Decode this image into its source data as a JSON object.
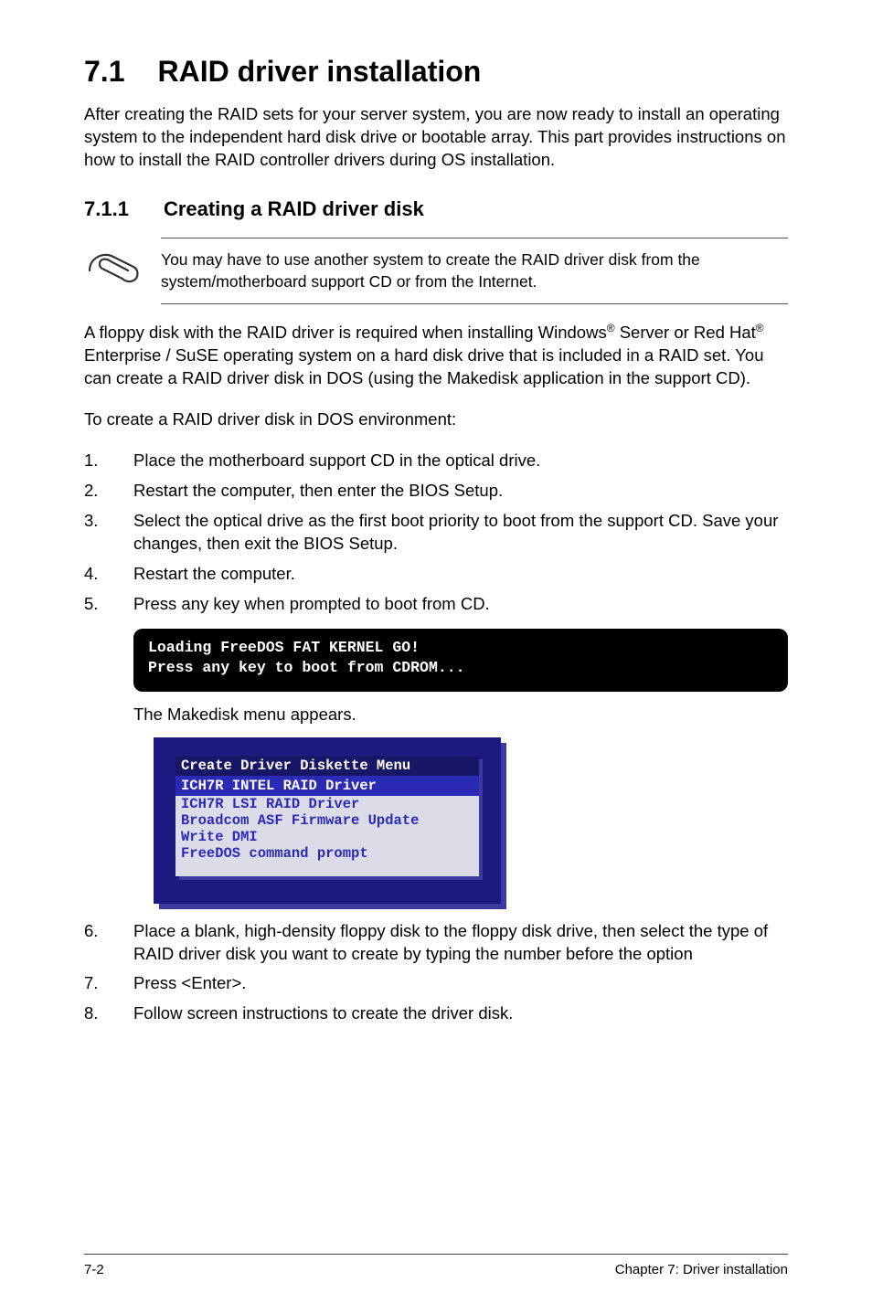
{
  "heading1": {
    "num": "7.1",
    "title": "RAID driver installation"
  },
  "intro": "After creating the RAID sets for your server system, you are now ready to install an operating system to the independent hard disk drive or bootable array. This part provides instructions on how to install the RAID controller drivers during OS installation.",
  "heading2": {
    "num": "7.1.1",
    "title": "Creating a RAID driver disk"
  },
  "note": "You may have to use another system to create the RAID driver disk from the system/motherboard support CD or from the Internet.",
  "para2_a": "A floppy disk with the RAID driver is required when installing Windows",
  "para2_b": " Server or Red Hat",
  "para2_c": " Enterprise / SuSE operating system on a hard disk drive that is included in a RAID set. You can create a RAID driver disk in DOS (using the Makedisk application in the support CD).",
  "para3": "To create a RAID driver disk in DOS environment:",
  "steps_a": [
    "Place the motherboard support CD in the optical drive.",
    "Restart the computer, then enter the BIOS Setup.",
    "Select the optical drive as the first boot priority to boot from the support CD. Save your changes, then exit the BIOS Setup.",
    "Restart the computer.",
    "Press any key when prompted to boot from CD."
  ],
  "terminal": "Loading FreeDOS FAT KERNEL GO!\nPress any key to boot from CDROM...",
  "makedisk_line": "The Makedisk menu appears.",
  "menu": {
    "title": "Create Driver Diskette Menu",
    "selected": "ICH7R INTEL RAID Driver",
    "items": [
      "ICH7R LSI RAID Driver",
      "Broadcom ASF Firmware Update",
      "Write DMI",
      "FreeDOS command prompt"
    ]
  },
  "steps_b": [
    "Place a blank, high-density floppy disk to the floppy disk drive, then select the type of RAID driver disk you want to create by typing the number before the option",
    "Press <Enter>.",
    "Follow screen instructions to create the driver disk."
  ],
  "footer": {
    "left": "7-2",
    "right": "Chapter 7: Driver installation"
  }
}
